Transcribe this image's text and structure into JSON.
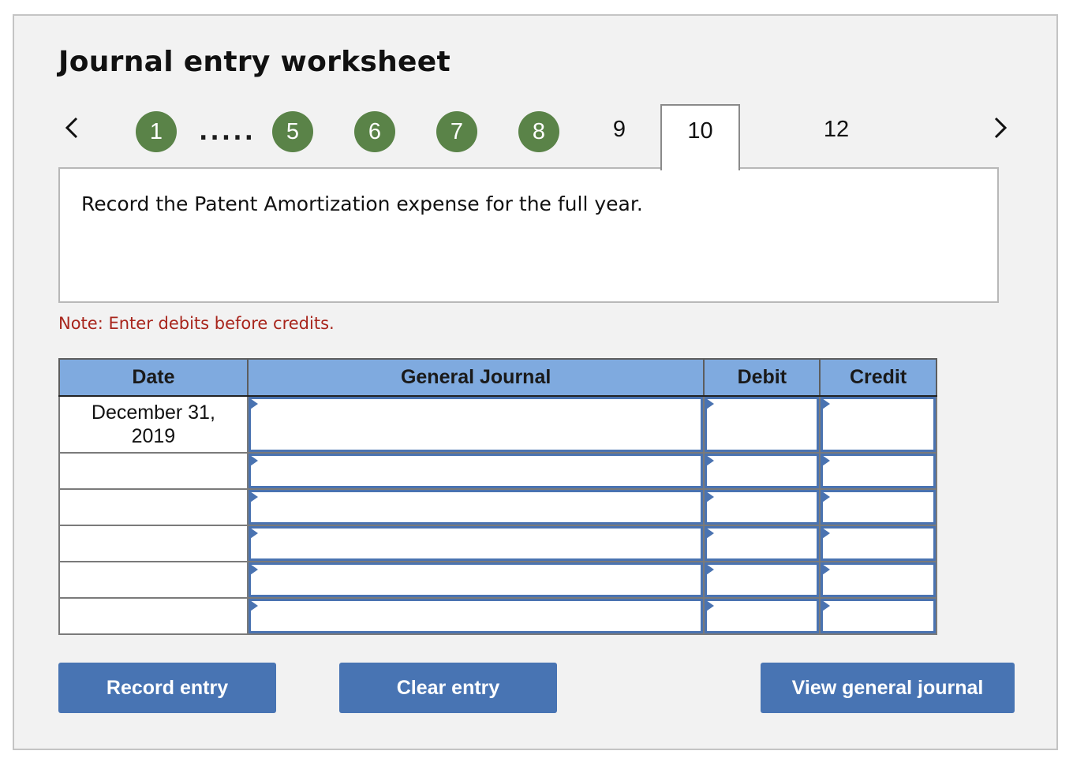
{
  "title": "Journal entry worksheet",
  "navigation": {
    "prev_icon": "chevron-left-icon",
    "next_icon": "chevron-right-icon",
    "completed_steps": [
      "1",
      "5",
      "6",
      "7",
      "8"
    ],
    "ellipsis": ".....",
    "pending_steps": [
      "9",
      "12"
    ],
    "active_step": "10",
    "completed_color": "#5a8348"
  },
  "prompt": "Record the Patent Amortization expense for the full year.",
  "note": "Note: Enter debits before credits.",
  "table": {
    "headers": [
      "Date",
      "General Journal",
      "Debit",
      "Credit"
    ],
    "rows": [
      {
        "date": "December 31, 2019",
        "account": "",
        "debit": "",
        "credit": ""
      },
      {
        "date": "",
        "account": "",
        "debit": "",
        "credit": ""
      },
      {
        "date": "",
        "account": "",
        "debit": "",
        "credit": ""
      },
      {
        "date": "",
        "account": "",
        "debit": "",
        "credit": ""
      },
      {
        "date": "",
        "account": "",
        "debit": "",
        "credit": ""
      },
      {
        "date": "",
        "account": "",
        "debit": "",
        "credit": ""
      }
    ],
    "header_color": "#7faadf",
    "input_border_color": "#4a73b1"
  },
  "buttons": {
    "record": "Record entry",
    "clear": "Clear entry",
    "view": "View general journal",
    "color": "#4874b3"
  }
}
